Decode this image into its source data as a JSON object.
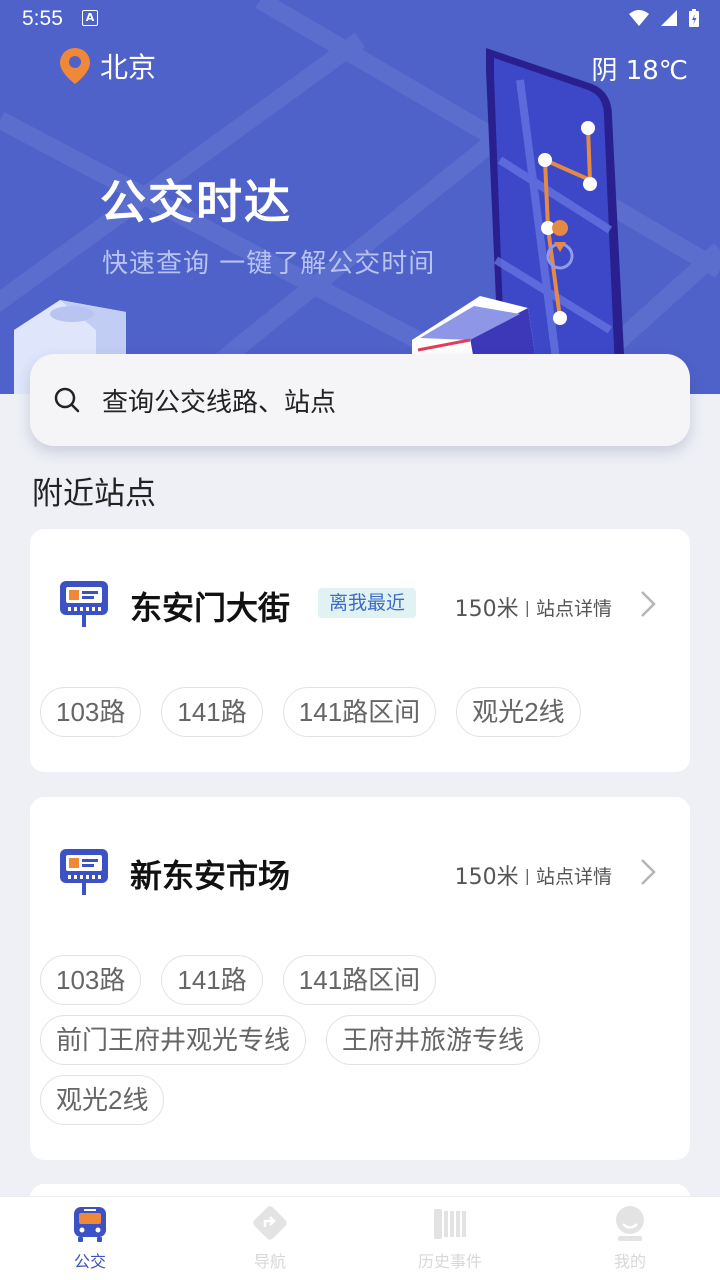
{
  "status_bar": {
    "time": "5:55",
    "notification_icon": "A"
  },
  "header": {
    "city": "北京",
    "weather": "阴 18℃",
    "title": "公交时达",
    "subtitle": "快速查询 一键了解公交时间"
  },
  "search": {
    "placeholder": "查询公交线路、站点"
  },
  "section_title": "附近站点",
  "stations": [
    {
      "name": "东安门大街",
      "badge": "离我最近",
      "distance": "150米",
      "separator": "|",
      "detail_link": "站点详情",
      "routes": [
        "103路",
        "141路",
        "141路区间",
        "观光2线"
      ]
    },
    {
      "name": "新东安市场",
      "distance": "150米",
      "separator": "|",
      "detail_link": "站点详情",
      "routes": [
        "103路",
        "141路",
        "141路区间",
        "前门王府井观光专线",
        "王府井旅游专线",
        "观光2线"
      ]
    }
  ],
  "tabs": [
    {
      "label": "公交",
      "icon": "bus-icon",
      "active": true
    },
    {
      "label": "导航",
      "icon": "navigation-icon",
      "active": false
    },
    {
      "label": "历史事件",
      "icon": "history-icon",
      "active": false
    },
    {
      "label": "我的",
      "icon": "profile-icon",
      "active": false
    }
  ],
  "colors": {
    "hero_bg": "#4f62c9",
    "accent": "#3c51c4",
    "location_pin": "#f0883a",
    "badge_bg": "#e1f2f2",
    "badge_text": "#3c6cc6",
    "page_bg": "#eef0f6"
  }
}
